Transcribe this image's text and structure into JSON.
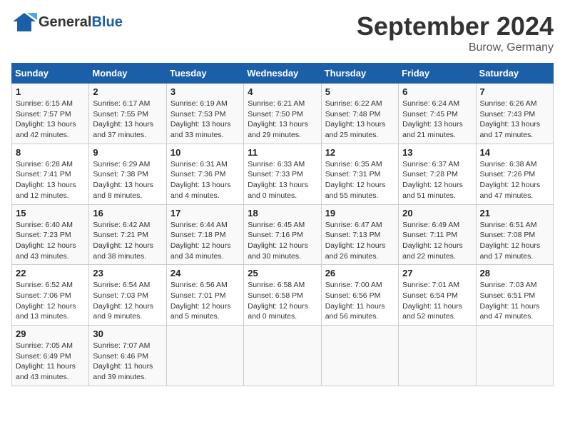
{
  "header": {
    "logo_text_general": "General",
    "logo_text_blue": "Blue",
    "month_title": "September 2024",
    "location": "Burow, Germany"
  },
  "columns": [
    "Sunday",
    "Monday",
    "Tuesday",
    "Wednesday",
    "Thursday",
    "Friday",
    "Saturday"
  ],
  "weeks": [
    [
      {
        "day": 1,
        "info": "Sunrise: 6:15 AM\nSunset: 7:57 PM\nDaylight: 13 hours\nand 42 minutes."
      },
      {
        "day": 2,
        "info": "Sunrise: 6:17 AM\nSunset: 7:55 PM\nDaylight: 13 hours\nand 37 minutes."
      },
      {
        "day": 3,
        "info": "Sunrise: 6:19 AM\nSunset: 7:53 PM\nDaylight: 13 hours\nand 33 minutes."
      },
      {
        "day": 4,
        "info": "Sunrise: 6:21 AM\nSunset: 7:50 PM\nDaylight: 13 hours\nand 29 minutes."
      },
      {
        "day": 5,
        "info": "Sunrise: 6:22 AM\nSunset: 7:48 PM\nDaylight: 13 hours\nand 25 minutes."
      },
      {
        "day": 6,
        "info": "Sunrise: 6:24 AM\nSunset: 7:45 PM\nDaylight: 13 hours\nand 21 minutes."
      },
      {
        "day": 7,
        "info": "Sunrise: 6:26 AM\nSunset: 7:43 PM\nDaylight: 13 hours\nand 17 minutes."
      }
    ],
    [
      {
        "day": 8,
        "info": "Sunrise: 6:28 AM\nSunset: 7:41 PM\nDaylight: 13 hours\nand 12 minutes."
      },
      {
        "day": 9,
        "info": "Sunrise: 6:29 AM\nSunset: 7:38 PM\nDaylight: 13 hours\nand 8 minutes."
      },
      {
        "day": 10,
        "info": "Sunrise: 6:31 AM\nSunset: 7:36 PM\nDaylight: 13 hours\nand 4 minutes."
      },
      {
        "day": 11,
        "info": "Sunrise: 6:33 AM\nSunset: 7:33 PM\nDaylight: 13 hours\nand 0 minutes."
      },
      {
        "day": 12,
        "info": "Sunrise: 6:35 AM\nSunset: 7:31 PM\nDaylight: 12 hours\nand 55 minutes."
      },
      {
        "day": 13,
        "info": "Sunrise: 6:37 AM\nSunset: 7:28 PM\nDaylight: 12 hours\nand 51 minutes."
      },
      {
        "day": 14,
        "info": "Sunrise: 6:38 AM\nSunset: 7:26 PM\nDaylight: 12 hours\nand 47 minutes."
      }
    ],
    [
      {
        "day": 15,
        "info": "Sunrise: 6:40 AM\nSunset: 7:23 PM\nDaylight: 12 hours\nand 43 minutes."
      },
      {
        "day": 16,
        "info": "Sunrise: 6:42 AM\nSunset: 7:21 PM\nDaylight: 12 hours\nand 38 minutes."
      },
      {
        "day": 17,
        "info": "Sunrise: 6:44 AM\nSunset: 7:18 PM\nDaylight: 12 hours\nand 34 minutes."
      },
      {
        "day": 18,
        "info": "Sunrise: 6:45 AM\nSunset: 7:16 PM\nDaylight: 12 hours\nand 30 minutes."
      },
      {
        "day": 19,
        "info": "Sunrise: 6:47 AM\nSunset: 7:13 PM\nDaylight: 12 hours\nand 26 minutes."
      },
      {
        "day": 20,
        "info": "Sunrise: 6:49 AM\nSunset: 7:11 PM\nDaylight: 12 hours\nand 22 minutes."
      },
      {
        "day": 21,
        "info": "Sunrise: 6:51 AM\nSunset: 7:08 PM\nDaylight: 12 hours\nand 17 minutes."
      }
    ],
    [
      {
        "day": 22,
        "info": "Sunrise: 6:52 AM\nSunset: 7:06 PM\nDaylight: 12 hours\nand 13 minutes."
      },
      {
        "day": 23,
        "info": "Sunrise: 6:54 AM\nSunset: 7:03 PM\nDaylight: 12 hours\nand 9 minutes."
      },
      {
        "day": 24,
        "info": "Sunrise: 6:56 AM\nSunset: 7:01 PM\nDaylight: 12 hours\nand 5 minutes."
      },
      {
        "day": 25,
        "info": "Sunrise: 6:58 AM\nSunset: 6:58 PM\nDaylight: 12 hours\nand 0 minutes."
      },
      {
        "day": 26,
        "info": "Sunrise: 7:00 AM\nSunset: 6:56 PM\nDaylight: 11 hours\nand 56 minutes."
      },
      {
        "day": 27,
        "info": "Sunrise: 7:01 AM\nSunset: 6:54 PM\nDaylight: 11 hours\nand 52 minutes."
      },
      {
        "day": 28,
        "info": "Sunrise: 7:03 AM\nSunset: 6:51 PM\nDaylight: 11 hours\nand 47 minutes."
      }
    ],
    [
      {
        "day": 29,
        "info": "Sunrise: 7:05 AM\nSunset: 6:49 PM\nDaylight: 11 hours\nand 43 minutes."
      },
      {
        "day": 30,
        "info": "Sunrise: 7:07 AM\nSunset: 6:46 PM\nDaylight: 11 hours\nand 39 minutes."
      },
      null,
      null,
      null,
      null,
      null
    ]
  ]
}
